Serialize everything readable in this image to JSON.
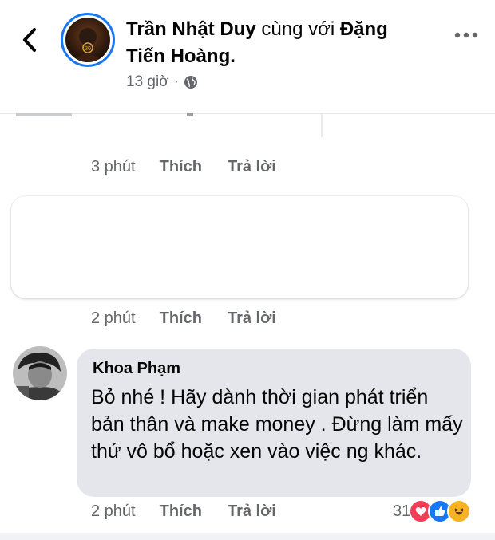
{
  "header": {
    "poster_name": "Trần Nhật Duy",
    "with_text": " cùng với ",
    "tagged_name_line1": "Đặng",
    "tagged_name_line2": "Tiến Hoàng.",
    "time": "13 giờ",
    "separator": "·"
  },
  "comments": [
    {
      "time": "3 phút",
      "like_label": "Thích",
      "reply_label": "Trả lời"
    },
    {
      "time": "2 phút",
      "like_label": "Thích",
      "reply_label": "Trả lời"
    },
    {
      "author": "Khoa Phạm",
      "text": "Bỏ nhé ! Hãy dành thời gian phát triển bản thân và make money . Đừng làm mấy thứ vô bổ hoặc xen vào việc ng khác.",
      "time": "2 phút",
      "like_label": "Thích",
      "reply_label": "Trả lời",
      "reaction_count": "31",
      "reactions": [
        "love",
        "like",
        "haha"
      ]
    }
  ],
  "colors": {
    "accent": "#1877f2",
    "love": "#f33e58",
    "haha": "#f7b125",
    "bubble": "#e4e6eb",
    "muted": "#65676b"
  }
}
